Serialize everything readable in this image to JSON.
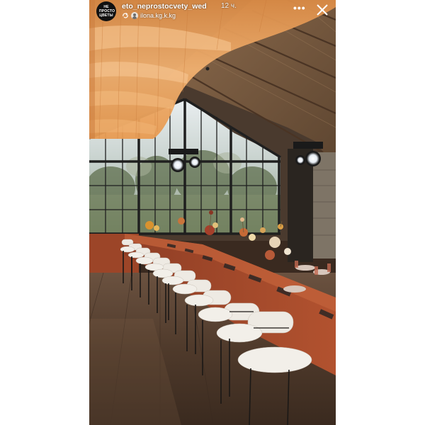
{
  "story": {
    "account": {
      "avatar_text": "НЕ ПРОСТО ЦВЕТЫ",
      "username": "eto_neprostocvety_wed",
      "posted_ago": "12 ч.",
      "collaborator": "ilona.kg.k.kg"
    },
    "icons": {
      "collaborator": "collab-icon",
      "more": "more-icon",
      "close": "close-icon"
    },
    "photo": {
      "subject": "banquet-hall-long-table",
      "colors": {
        "drape": "#e8a35e",
        "tablecloth": "#a84a2c",
        "chairs": "#f2efe9",
        "ceiling": "#7a5a40",
        "floor": "#5b4433"
      }
    }
  }
}
